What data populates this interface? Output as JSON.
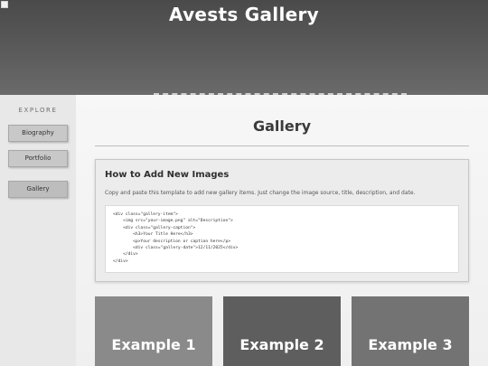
{
  "header": {
    "title": "Avests Gallery"
  },
  "sidebar": {
    "heading": "EXPLORE",
    "items": [
      {
        "label": "Biography"
      },
      {
        "label": "Portfolio"
      },
      {
        "label": "Gallery"
      }
    ]
  },
  "main": {
    "title": "Gallery",
    "howto": {
      "title": "How to Add New Images",
      "description": "Copy and paste this template to add new gallery items. Just change the image source, title, description, and date.",
      "code": "<div class=\"gallery-item\">\n    <img src=\"your-image.png\" alt=\"Description\">\n    <div class=\"gallery-caption\">\n        <h3>Your Title Here</h3>\n        <p>Your description or caption here</p>\n        <div class=\"gallery-date\">12/11/2025</div>\n    </div>\n</div>"
    },
    "cards": [
      {
        "label": "Example 1",
        "color": "#8a8a8a"
      },
      {
        "label": "Example 2",
        "color": "#5e5e5e"
      },
      {
        "label": "Example 3",
        "color": "#737373"
      }
    ]
  }
}
